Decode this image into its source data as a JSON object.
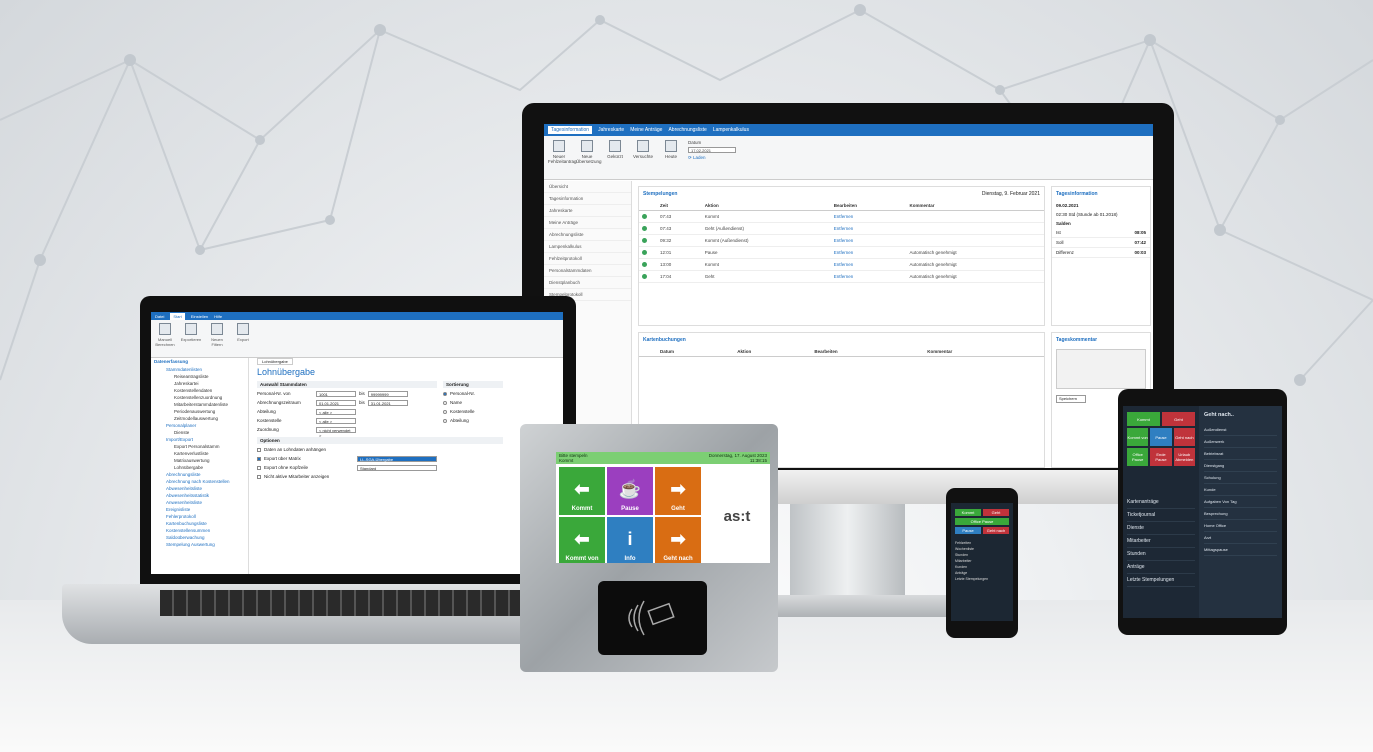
{
  "colors": {
    "accent": "#1e6fc0",
    "green": "#3aa83a",
    "purple": "#9b3fbf",
    "orange": "#d96d13",
    "red": "#c0333b"
  },
  "monitor": {
    "tabs": [
      "Tagesinformation",
      "Jahreskarte",
      "Meine Anträge",
      "Abrechnungsliste",
      "Lampenkalkulus"
    ],
    "ribbon": {
      "buttons": [
        "Neuer Fehlzeitantrag",
        "Neue Übersetzung",
        "Gekürzt",
        "Versuchte",
        "Heute"
      ],
      "date_label": "Datum",
      "date_value": "17.02.2021",
      "reload": "Laden",
      "groups": [
        "Anträge erstellen",
        "Zeitraum",
        "Zeitraum"
      ]
    },
    "sidebar": [
      "Übersicht",
      "Tagesinformation",
      "Jahreskarte",
      "Meine Anträge",
      "Abrechnungsliste",
      "Lampenkalkulus",
      "Fehlzeitprotokoll",
      "Personalstammdaten",
      "Dienstplanbuch",
      "Stempelprotokoll"
    ],
    "bookings": {
      "title": "Stempelungen",
      "date": "Dienstag, 9. Februar 2021",
      "headers": [
        "Zeit",
        "Aktion",
        "Bearbeiten",
        "Kommentar"
      ],
      "rows": [
        [
          "07:43",
          "Kommt",
          "Entfernen",
          ""
        ],
        [
          "07:43",
          "Geht (Außendienst)",
          "Entfernen",
          ""
        ],
        [
          "09:32",
          "Kommt (Außendienst)",
          "Entfernen",
          ""
        ],
        [
          "12:01",
          "Pause",
          "Entfernen",
          "Automatisch genehmigt"
        ],
        [
          "13:00",
          "Kommt",
          "Entfernen",
          "Automatisch genehmigt"
        ],
        [
          "17:04",
          "Geht",
          "Entfernen",
          "Automatisch genehmigt"
        ]
      ]
    },
    "card_bookings": {
      "title": "Kartenbuchungen",
      "headers": [
        "Datum",
        "Aktion",
        "Bearbeiten",
        "Kommentar"
      ]
    },
    "day_info": {
      "title": "Tagesinformation",
      "date": "09.02.2021",
      "line": "02:30 Std (Stunde ab 01.2018)",
      "section": "Salden",
      "rows": [
        [
          "Ist",
          "08:05"
        ],
        [
          "Soll",
          "07:42"
        ],
        [
          "Differenz",
          "00:03"
        ]
      ]
    },
    "day_comment": {
      "title": "Tageskommentar",
      "save": "Speichern"
    }
  },
  "laptop": {
    "tabs": [
      "Datei",
      "Start",
      "Einstellen",
      "Hilfe"
    ],
    "ribbon": [
      "Manuell Berechnen",
      "Exportieren",
      "Neuen Filtern",
      "Export"
    ],
    "sidebar_title": "Datenerfassung",
    "tree": [
      [
        "Stammdatenlisten",
        1
      ],
      [
        "Reiseantragsliste",
        2
      ],
      [
        "Jahreskartei",
        2
      ],
      [
        "Kostenstellendaten",
        2
      ],
      [
        "Kostenstellenzuordnung",
        2
      ],
      [
        "Mitarbeiterstammdatenliste",
        2
      ],
      [
        "Periodenauswertung",
        2
      ],
      [
        "Zeitmodellauswertung",
        2
      ],
      [
        "Personalplaner",
        1
      ],
      [
        "Dienste",
        2
      ],
      [
        "Import/Export",
        1
      ],
      [
        "Export Personalstamm",
        2
      ],
      [
        "Kartenverlustliste",
        2
      ],
      [
        "Matrixauswertung",
        2
      ],
      [
        "Lohnübergabe",
        2
      ],
      [
        "Abrechnungsliste",
        1
      ],
      [
        "Abrechnung nach Kostenstellen",
        1
      ],
      [
        "Abwesenheitsliste",
        1
      ],
      [
        "Abwesenheitsstatistik",
        1
      ],
      [
        "Anwesenheitsliste",
        1
      ],
      [
        "Ereignisliste",
        1
      ],
      [
        "Fehlerprotokoll",
        1
      ],
      [
        "Kartenbuchungsliste",
        1
      ],
      [
        "Kostenstellensummen",
        1
      ],
      [
        "Saldoüberwachung",
        1
      ],
      [
        "Stempelung Auswertung",
        1
      ]
    ],
    "doc_tab": "Lohnübergabe",
    "title": "Lohnübergabe",
    "section1": "Auswahl Stammdaten",
    "fields": [
      [
        "Personal-Nr. von",
        "1001",
        "bis",
        "99999999"
      ],
      [
        "Abrechnungszeitraum",
        "01.01.2021",
        "bis",
        "31.01.2021"
      ],
      [
        "Abteilung",
        "< alle >",
        "",
        ""
      ],
      [
        "Kostenstelle",
        "< alle >",
        "",
        ""
      ],
      [
        "Zuordnung",
        "< nicht verwendet >",
        "",
        ""
      ]
    ],
    "sort_title": "Sortierung",
    "sort": [
      "Personal-Nr.",
      "Name",
      "Kostenstelle",
      "Abteilung"
    ],
    "section2": "Optionen",
    "options": [
      "Daten an Lohndaten anhängen",
      "Export über Matrix",
      "Export ohne Kopfzeile",
      "Nicht aktive Mitarbeiter anzeigen"
    ],
    "option_select": "LL-SGA-Übergabe",
    "option_select2": "Standard"
  },
  "terminal": {
    "status_left": "Bitte stempeln",
    "status_left2": "Kommt",
    "date": "Donnerstag, 17. August 2023",
    "time": "11:38:15",
    "tiles": [
      {
        "label": "Kommt",
        "icon": "arrow-in-icon",
        "color": "#3aa83a",
        "glyph": "⬅"
      },
      {
        "label": "Pause",
        "icon": "cup-icon",
        "color": "#9b3fbf",
        "glyph": "☕"
      },
      {
        "label": "Geht",
        "icon": "arrow-out-icon",
        "color": "#d96d13",
        "glyph": "➡"
      },
      {
        "label": "Kommt von",
        "icon": "arrow-in-icon",
        "color": "#3aa83a",
        "glyph": "⬅"
      },
      {
        "label": "Info",
        "icon": "info-icon",
        "color": "#2f7fc1",
        "glyph": "i"
      },
      {
        "label": "Geht nach",
        "icon": "arrow-out-icon",
        "color": "#d96d13",
        "glyph": "➡"
      }
    ],
    "logo": "as:t"
  },
  "phone": {
    "menu": [
      "Fehlzeiten",
      "Wochenliste",
      "Stunden",
      "Mitarbeiter",
      "Kunden",
      "Anträge",
      "Letzte Stempelungen"
    ]
  },
  "tablet": {
    "buttons": {
      "kommt": "Kommt",
      "geht": "Geht",
      "kommt_von": "Kommt von",
      "pause": "Pause",
      "geht_nach": "Geht nach",
      "office_pause": "Office Pause",
      "ende_pause": "Ende Pause",
      "urlaub": "Urlaub Abmelden"
    },
    "left_menu": [
      "Kartenanträge",
      "Ticketjournal",
      "Dienste",
      "Mitarbeiter",
      "Stunden",
      "Anträge",
      "Letzte Stempelungen"
    ],
    "right_title": "Geht nach..",
    "right_menu": [
      "Außendienst",
      "Außenwerk",
      "Betriebsrat",
      "Dienstgang",
      "Schulung",
      "Kunde",
      "Aufgaben Von Tag",
      "Besprechung",
      "Home Office",
      "Arzt",
      "Mittagspause"
    ]
  }
}
